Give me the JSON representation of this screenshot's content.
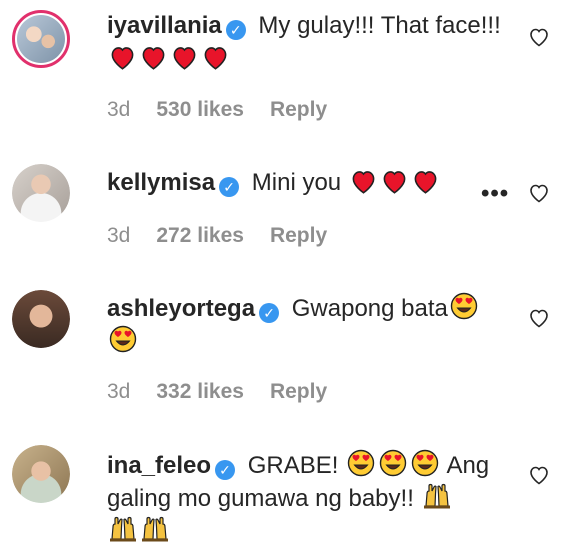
{
  "comments": [
    {
      "username": "iyavillania",
      "text_before": "My gulay!!! That face!!!",
      "emojis": [
        "red-heart",
        "red-heart",
        "red-heart",
        "red-heart"
      ],
      "age": "3d",
      "likes": "530 likes",
      "reply": "Reply"
    },
    {
      "username": "kellymisa",
      "text_before": "Mini you",
      "emojis": [
        "red-heart",
        "red-heart",
        "red-heart"
      ],
      "more": "•••",
      "age": "3d",
      "likes": "272 likes",
      "reply": "Reply"
    },
    {
      "username": "ashleyortega",
      "text_before": "Gwapong bata",
      "emojis": [
        "heart-eyes",
        "heart-eyes"
      ],
      "age": "3d",
      "likes": "332 likes",
      "reply": "Reply"
    },
    {
      "username": "ina_feleo",
      "text_before": "GRABE!",
      "emojis_mid": [
        "heart-eyes",
        "heart-eyes",
        "heart-eyes"
      ],
      "text_after": "Ang galing mo gumawa ng baby!!",
      "emojis": [
        "raising-hands",
        "raising-hands",
        "raising-hands"
      ]
    }
  ],
  "verified_glyph": "✓",
  "colors": {
    "verified": "#3897f0",
    "meta": "#8e8e8e",
    "heart": "#ed4956",
    "text": "#262626"
  }
}
